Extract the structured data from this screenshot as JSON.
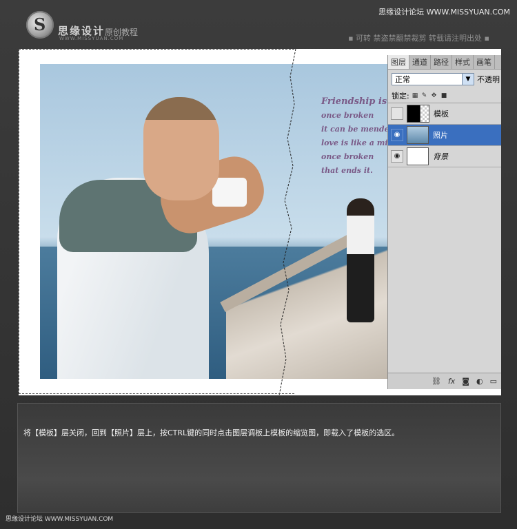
{
  "site": {
    "logo_name": "思缘设计",
    "logo_sub": "原创教程",
    "logo_url": "WWW.MISSYUAN.COM",
    "top_right": "思缘设计论坛 WWW.MISSYUAN.COM",
    "notice": "▪ 可转  禁盗禁翻禁裁剪  转载请注明出处 ▪"
  },
  "photo": {
    "poem": [
      "Friendship is lit",
      "once broken",
      "it can be mende",
      "love is like a mi",
      "once broken",
      "that ends it."
    ]
  },
  "layers_panel": {
    "tabs": [
      "图层",
      "通道",
      "路径",
      "样式",
      "画笔"
    ],
    "blend_mode": "正常",
    "opacity_label": "不透明",
    "lock_label": "锁定:",
    "layers": [
      {
        "name": "模板",
        "visible": false,
        "selected": false
      },
      {
        "name": "照片",
        "visible": true,
        "selected": true
      },
      {
        "name": "背景",
        "visible": true,
        "selected": false
      }
    ],
    "footer_icons": [
      "link-icon",
      "fx-icon",
      "mask-icon",
      "adjustment-icon",
      "new-layer-icon"
    ]
  },
  "caption": "将【模板】层关闭，回到【照片】层上，按CTRL键的同时点击图层调板上模板的缩览图，即载入了模板的选区。",
  "footer": "思缘设计论坛 WWW.MISSYUAN.COM",
  "colors": {
    "selected_layer": "#3a6fbf",
    "poem_text": "#7a5a87"
  }
}
